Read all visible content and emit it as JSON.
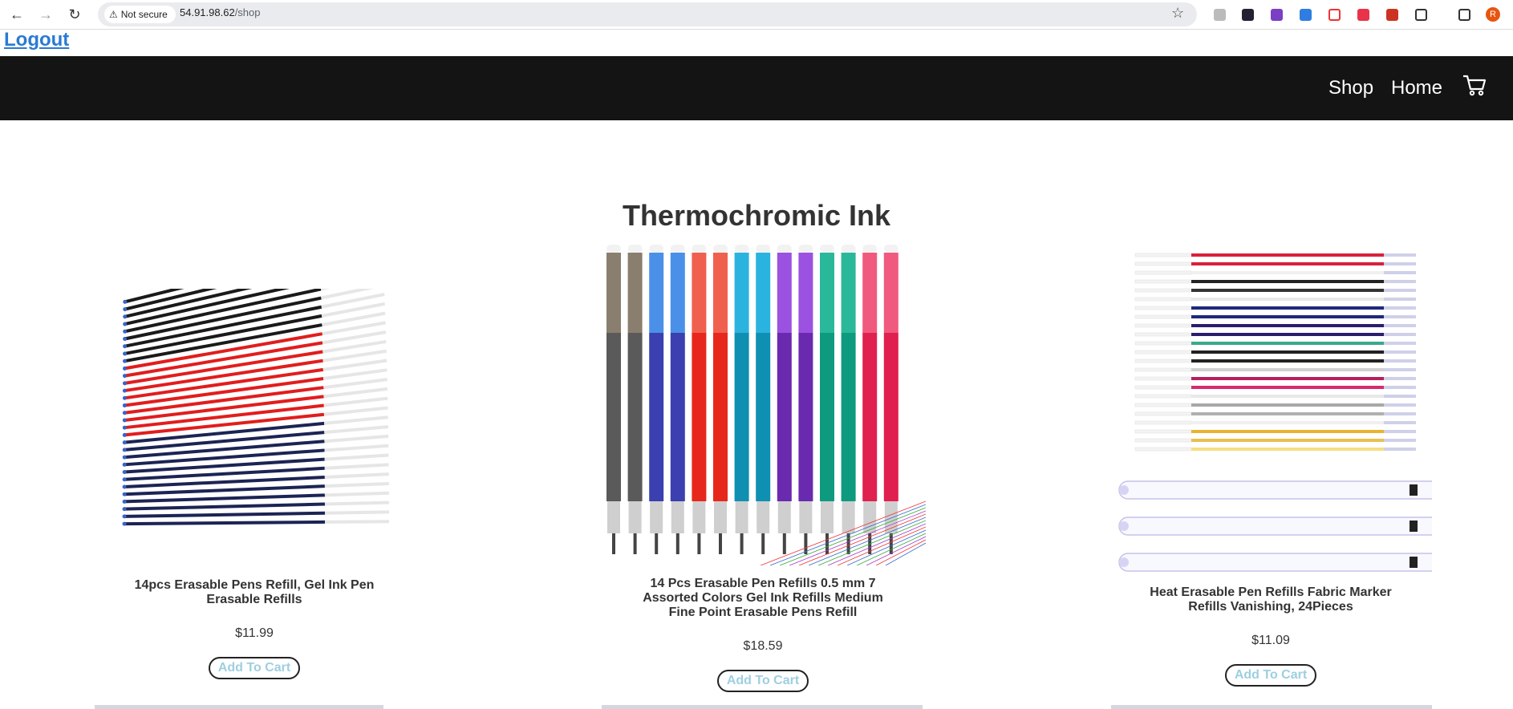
{
  "browser": {
    "security_label": "Not secure",
    "url_host": "54.91.98.62",
    "url_path": "/shop",
    "profile_initial": "R"
  },
  "top": {
    "logout": "Logout"
  },
  "nav": {
    "shop": "Shop",
    "home": "Home"
  },
  "page": {
    "title": "Thermochromic Ink"
  },
  "products": [
    {
      "name": "14pcs Erasable Pens Refill, Gel Ink Pen Erasable Refills",
      "price": "$11.99",
      "button": "Add To Cart"
    },
    {
      "name": "14 Pcs Erasable Pen Refills 0.5 mm 7 Assorted Colors Gel Ink Refills Medium Fine Point Erasable Pens Refill",
      "price": "$18.59",
      "button": "Add To Cart"
    },
    {
      "name": "Heat Erasable Pen Refills Fabric Marker Refills Vanishing, 24Pieces",
      "price": "$11.09",
      "button": "Add To Cart"
    }
  ],
  "colors": {
    "header_bg": "#141414",
    "link": "#2a7ad2",
    "button_text": "#9ecfe0"
  }
}
